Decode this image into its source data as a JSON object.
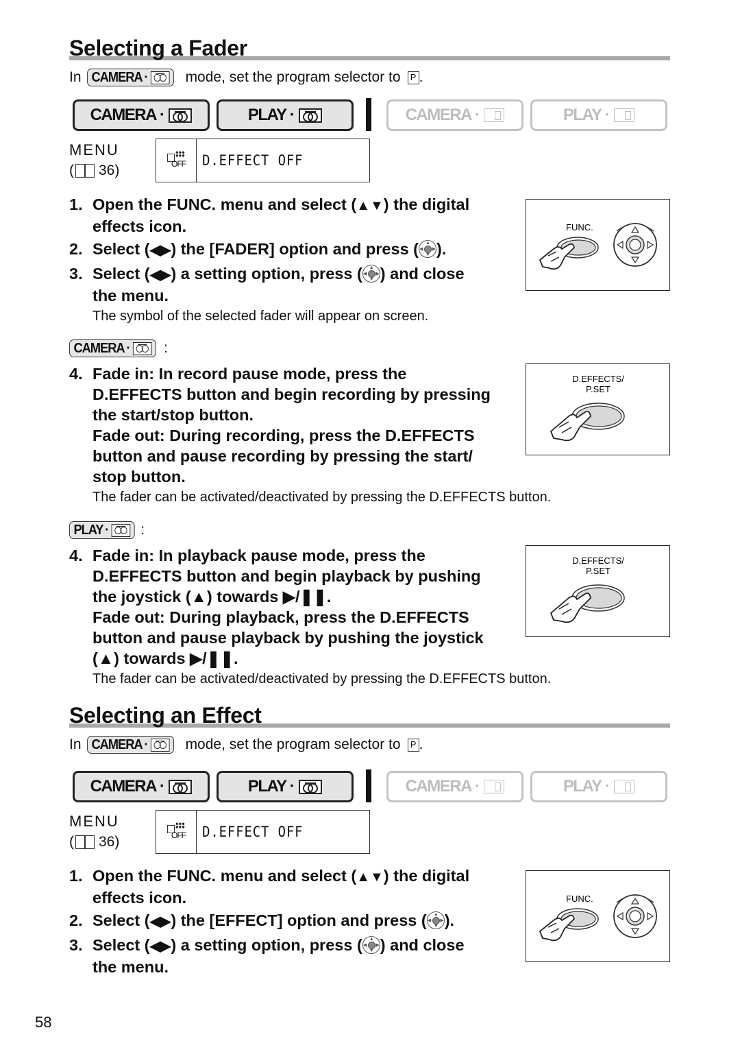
{
  "page_number": "58",
  "sections": [
    {
      "title": "Selecting a Fader",
      "intro": {
        "prefix": "In",
        "mode_badge": "CAMERA",
        "suffix": "mode, set the program selector to",
        "selector": "P",
        "end": "."
      },
      "modes": [
        {
          "label": "CAMERA",
          "media": "tape-icon",
          "active": true
        },
        {
          "label": "PLAY",
          "media": "tape-icon",
          "active": true
        },
        {
          "label": "CAMERA",
          "media": "card-icon",
          "active": false
        },
        {
          "label": "PLAY",
          "media": "card-icon",
          "active": false
        }
      ],
      "menu": {
        "label": "MENU",
        "ref_open": "(",
        "ref_page": "36)",
        "icon_text": "OFF",
        "value": "D.EFFECT OFF"
      },
      "steps": [
        {
          "num": "1.",
          "line1": "Open the FUNC. menu and select (",
          "sym": "▲▼",
          "line1b": ") the digital",
          "line2": "effects icon."
        },
        {
          "num": "2.",
          "pre": "Select (",
          "sym": "◀▶",
          "mid": ") the [FADER] option and press (",
          "post": ")."
        },
        {
          "num": "3.",
          "pre": "Select (",
          "sym": "◀▶",
          "mid": ") a setting option, press (",
          "post": ") and close",
          "line2": "the menu."
        }
      ],
      "note": "The symbol of the selected fader will appear on screen.",
      "illus_func_label": "FUNC.",
      "camera_block": {
        "badge": "CAMERA",
        "colon": ":",
        "num": "4.",
        "lines": [
          "Fade in: In record pause mode, press the",
          "D.EFFECTS button and begin recording by pressing",
          "the start/stop button.",
          "Fade out: During recording, press the D.EFFECTS",
          "button and pause recording by pressing the start/",
          "stop button."
        ],
        "note": "The fader can be activated/deactivated by pressing the D.EFFECTS button.",
        "illus_label_1": "D.EFFECTS/",
        "illus_label_2": "P.SET"
      },
      "play_block": {
        "badge": "PLAY",
        "colon": ":",
        "num": "4.",
        "lines": [
          "Fade in: In playback pause mode, press the",
          "D.EFFECTS button and begin playback by pushing",
          "the joystick (▲) towards ▶/❚❚.",
          "Fade out: During playback, press the D.EFFECTS",
          "button and pause playback by pushing the joystick",
          "(▲) towards ▶/❚❚."
        ],
        "note": "The fader can be activated/deactivated by pressing the D.EFFECTS button.",
        "illus_label_1": "D.EFFECTS/",
        "illus_label_2": "P.SET"
      }
    },
    {
      "title": "Selecting an Effect",
      "intro": {
        "prefix": "In",
        "mode_badge": "CAMERA",
        "suffix": "mode, set the program selector to",
        "selector": "P",
        "end": "."
      },
      "menu": {
        "label": "MENU",
        "ref_open": "(",
        "ref_page": "36)",
        "icon_text": "OFF",
        "value": "D.EFFECT OFF"
      },
      "steps": [
        {
          "num": "1.",
          "line1": "Open the FUNC. menu and select (",
          "sym": "▲▼",
          "line1b": ") the digital",
          "line2": "effects icon."
        },
        {
          "num": "2.",
          "pre": "Select (",
          "sym": "◀▶",
          "mid": ") the [EFFECT] option and press (",
          "post": ")."
        },
        {
          "num": "3.",
          "pre": "Select (",
          "sym": "◀▶",
          "mid": ") a setting option, press (",
          "post": ") and close",
          "line2": "the menu."
        }
      ],
      "illus_func_label": "FUNC."
    }
  ]
}
